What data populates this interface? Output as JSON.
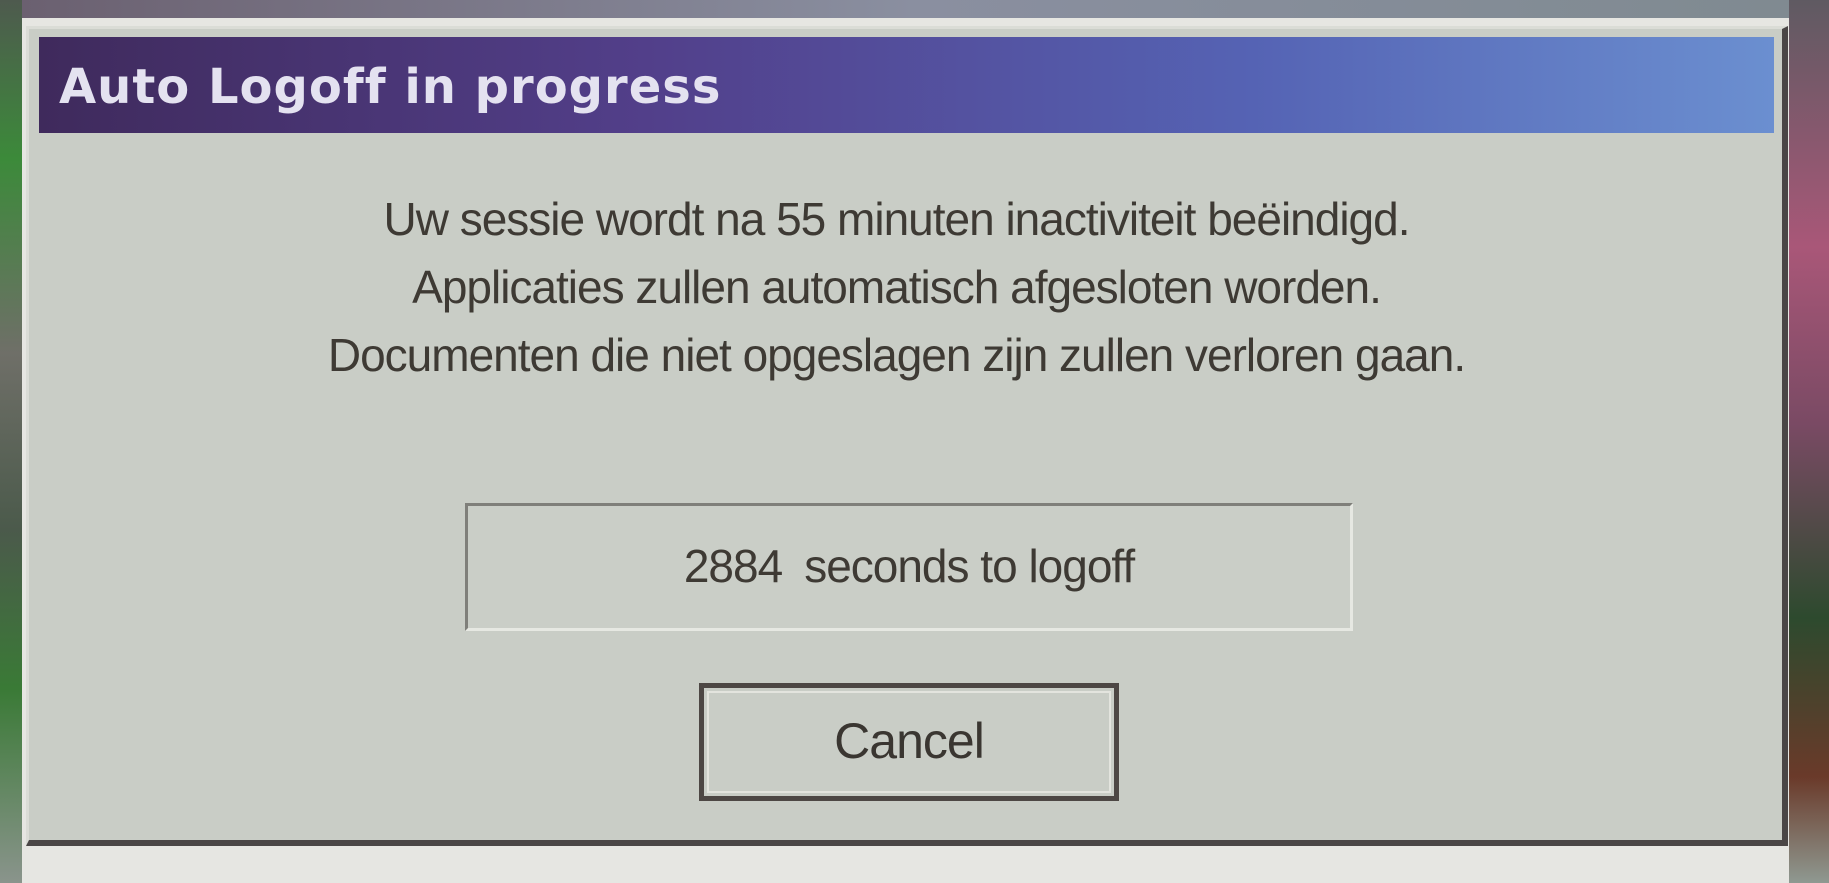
{
  "dialog": {
    "title": "Auto Logoff in progress",
    "message_lines": [
      "Uw sessie wordt na 55 minuten inactiviteit beëindigd.",
      "Applicaties zullen automatisch afgesloten worden.",
      "Documenten die niet opgeslagen zijn zullen verloren gaan."
    ],
    "countdown": {
      "seconds": "2884",
      "suffix": "seconds to logoff"
    },
    "cancel_label": "Cancel"
  },
  "colors": {
    "titlebar_start": "#3f2a5c",
    "titlebar_end": "#6b8fd0",
    "dialog_bg": "#c9cdc6",
    "text": "#3e3a34"
  }
}
